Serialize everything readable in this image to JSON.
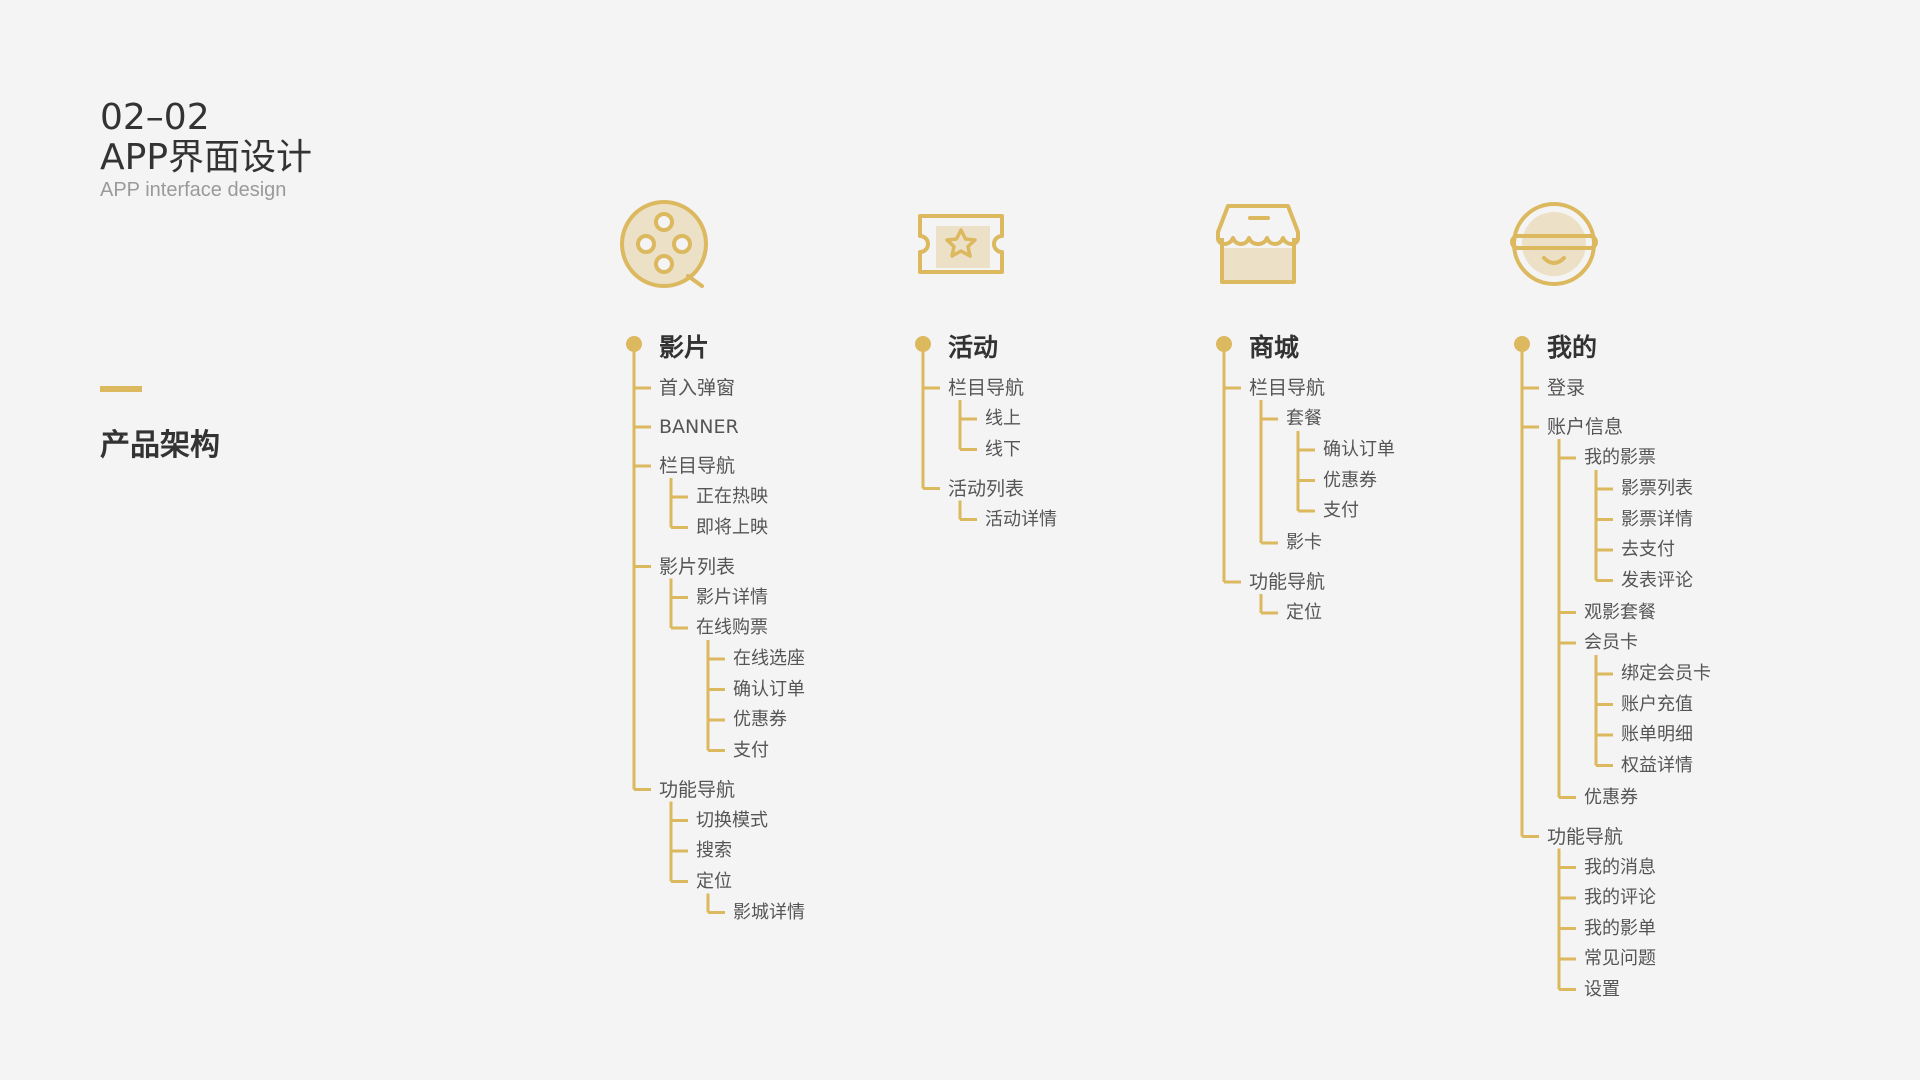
{
  "header": {
    "code": "02–02",
    "title": "APP界面设计",
    "subtitle": "APP interface design"
  },
  "section_title": "产品架构",
  "colors": {
    "accent": "#dcb85e",
    "accent_fill": "#ece0c6",
    "text": "#555555",
    "heading": "#333333",
    "background": "#f4f4f4"
  },
  "columns": [
    {
      "title": "影片",
      "icon": "film-reel-icon",
      "items": [
        {
          "label": "首入弹窗",
          "level": 1
        },
        {
          "label": "BANNER",
          "level": 1
        },
        {
          "label": "栏目导航",
          "level": 1
        },
        {
          "label": "正在热映",
          "level": 2
        },
        {
          "label": "即将上映",
          "level": 2
        },
        {
          "label": "影片列表",
          "level": 1
        },
        {
          "label": "影片详情",
          "level": 2
        },
        {
          "label": "在线购票",
          "level": 2
        },
        {
          "label": "在线选座",
          "level": 3
        },
        {
          "label": "确认订单",
          "level": 3
        },
        {
          "label": "优惠券",
          "level": 3
        },
        {
          "label": "支付",
          "level": 3
        },
        {
          "label": "功能导航",
          "level": 1
        },
        {
          "label": "切换模式",
          "level": 2
        },
        {
          "label": "搜索",
          "level": 2
        },
        {
          "label": "定位",
          "level": 2
        },
        {
          "label": "影城详情",
          "level": 3
        }
      ]
    },
    {
      "title": "活动",
      "icon": "ticket-star-icon",
      "items": [
        {
          "label": "栏目导航",
          "level": 1
        },
        {
          "label": "线上",
          "level": 2
        },
        {
          "label": "线下",
          "level": 2
        },
        {
          "label": "活动列表",
          "level": 1
        },
        {
          "label": "活动详情",
          "level": 2
        }
      ]
    },
    {
      "title": "商城",
      "icon": "store-icon",
      "items": [
        {
          "label": "栏目导航",
          "level": 1
        },
        {
          "label": "套餐",
          "level": 2
        },
        {
          "label": "确认订单",
          "level": 3
        },
        {
          "label": "优惠券",
          "level": 3
        },
        {
          "label": "支付",
          "level": 3
        },
        {
          "label": "影卡",
          "level": 2
        },
        {
          "label": "功能导航",
          "level": 1
        },
        {
          "label": "定位",
          "level": 2
        }
      ]
    },
    {
      "title": "我的",
      "icon": "face-glasses-icon",
      "items": [
        {
          "label": "登录",
          "level": 1
        },
        {
          "label": "账户信息",
          "level": 1
        },
        {
          "label": "我的影票",
          "level": 2
        },
        {
          "label": "影票列表",
          "level": 3
        },
        {
          "label": "影票详情",
          "level": 3
        },
        {
          "label": "去支付",
          "level": 3
        },
        {
          "label": "发表评论",
          "level": 3
        },
        {
          "label": "观影套餐",
          "level": 2
        },
        {
          "label": "会员卡",
          "level": 2
        },
        {
          "label": "绑定会员卡",
          "level": 3
        },
        {
          "label": "账户充值",
          "level": 3
        },
        {
          "label": "账单明细",
          "level": 3
        },
        {
          "label": "权益详情",
          "level": 3
        },
        {
          "label": "优惠券",
          "level": 2
        },
        {
          "label": "功能导航",
          "level": 1
        },
        {
          "label": "我的消息",
          "level": 2
        },
        {
          "label": "我的评论",
          "level": 2
        },
        {
          "label": "我的影单",
          "level": 2
        },
        {
          "label": "常见问题",
          "level": 2
        },
        {
          "label": "设置",
          "level": 2
        }
      ]
    }
  ]
}
